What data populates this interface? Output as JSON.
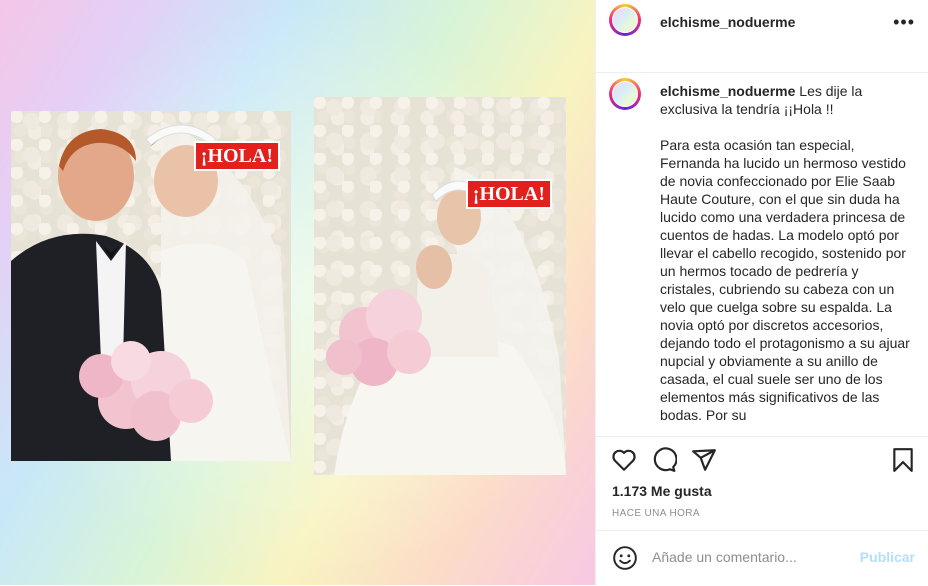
{
  "post": {
    "media": {
      "badge1": "¡HOLA!",
      "badge2": "¡HOLA!"
    }
  },
  "header": {
    "username": "elchisme_noduerme",
    "more_label": "•••"
  },
  "caption": {
    "username": "elchisme_noduerme",
    "intro": "Les dije la exclusiva la tendría ¡¡Hola !!",
    "body": "Para esta ocasión tan especial, Fernanda ha lucido un hermoso vestido de novia confeccionado por Elie Saab Haute Couture, con el que sin duda ha lucido como una verdadera princesa de cuentos de hadas. La modelo optó por llevar el cabello recogido, sostenido por un hermos tocado de pedrería y cristales, cubriendo su cabeza con un velo que cuelga sobre su espalda. La novia optó por discretos accesorios, dejando todo el protagonismo a su ajuar nupcial y obviamente a su anillo de casada, el cual suele ser uno de los elementos más significativos de las bodas. Por su"
  },
  "stats": {
    "likes": "1.173 Me gusta",
    "time": "HACE UNA HORA"
  },
  "comment_box": {
    "placeholder": "Añade un comentario...",
    "publish_label": "Publicar"
  },
  "icons": [
    "heart-icon",
    "comment-icon",
    "share-icon",
    "bookmark-icon",
    "smile-icon"
  ]
}
